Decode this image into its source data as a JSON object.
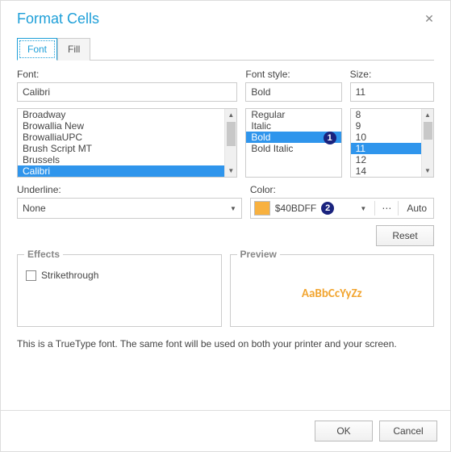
{
  "title": "Format Cells",
  "tabs": {
    "font": "Font",
    "fill": "Fill"
  },
  "labels": {
    "font": "Font:",
    "style": "Font style:",
    "size": "Size:",
    "underline": "Underline:",
    "color": "Color:"
  },
  "fontField": {
    "value": "Calibri"
  },
  "fontList": [
    "Broadway",
    "Browallia New",
    "BrowalliaUPC",
    "Brush Script MT",
    "Brussels",
    "Calibri"
  ],
  "fontSelectedIndex": 5,
  "styleField": {
    "value": "Bold"
  },
  "styleList": [
    "Regular",
    "Italic",
    "Bold",
    "Bold Italic"
  ],
  "styleSelectedIndex": 2,
  "sizeField": {
    "value": "11"
  },
  "sizeList": [
    "8",
    "9",
    "10",
    "11",
    "12",
    "14"
  ],
  "sizeSelectedIndex": 3,
  "underline": {
    "value": "None"
  },
  "color": {
    "hex": "$40BDFF",
    "auto": "Auto"
  },
  "buttons": {
    "reset": "Reset",
    "ok": "OK",
    "cancel": "Cancel"
  },
  "groups": {
    "effects": "Effects",
    "preview": "Preview"
  },
  "effects": {
    "strikethrough": "Strikethrough"
  },
  "preview": {
    "sample": "AaBbCcYyZz"
  },
  "footer": "This is a TrueType font. The same font will be used on both your printer and your screen.",
  "callouts": {
    "one": "1",
    "two": "2"
  },
  "ellipsis": "⋯"
}
